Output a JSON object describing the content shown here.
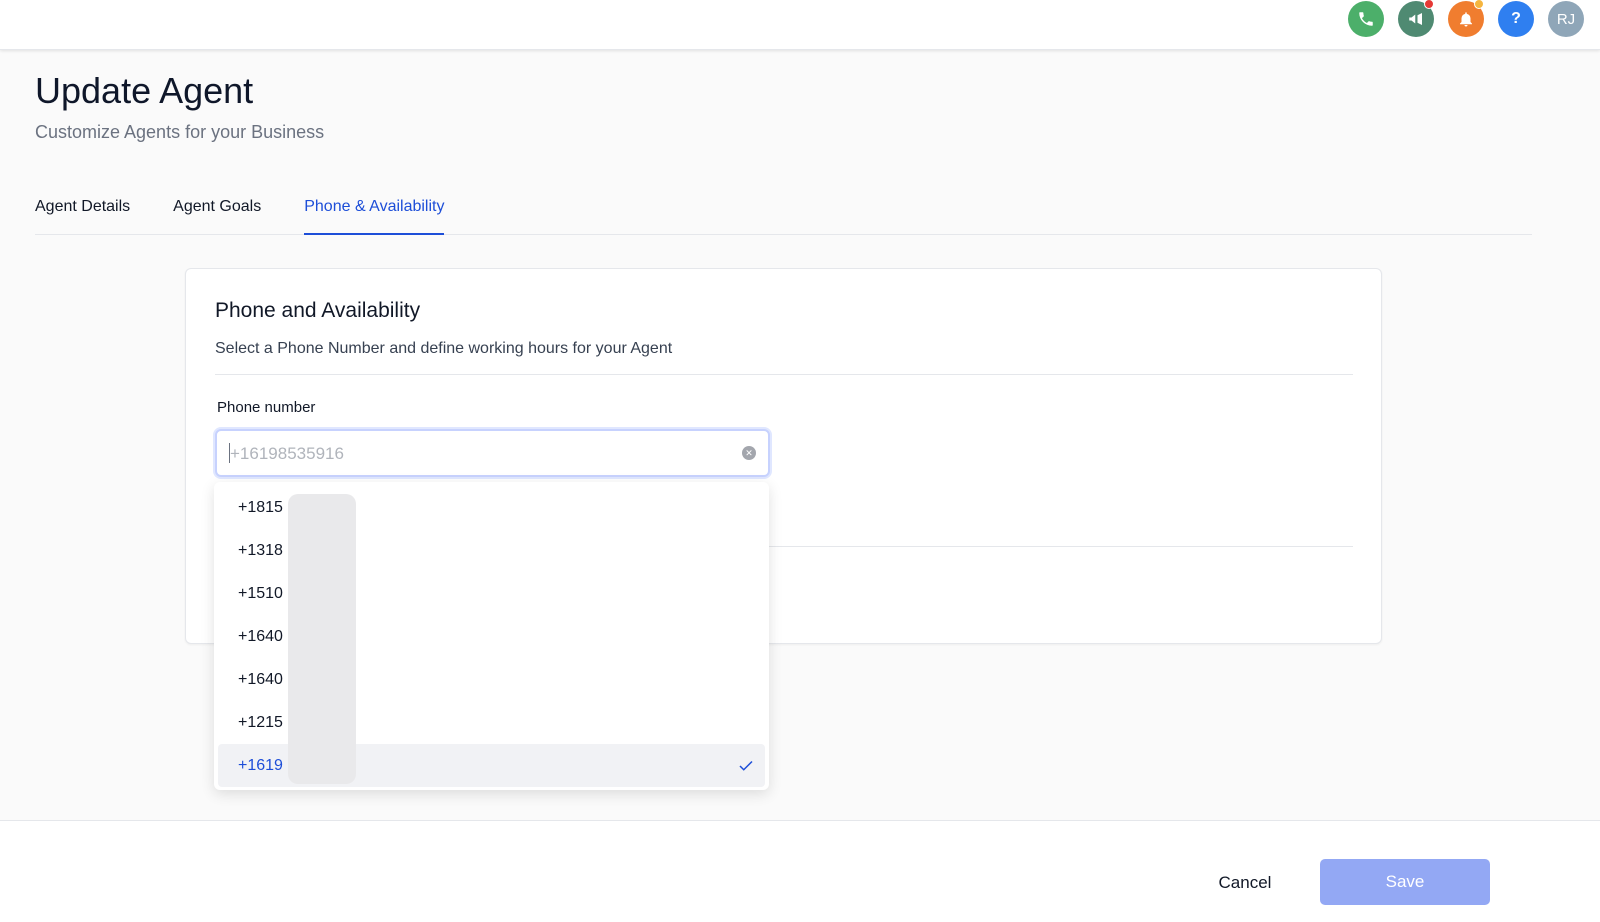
{
  "header": {
    "title": "Update Agent",
    "subtitle": "Customize Agents for your Business",
    "avatar_initials": "RJ",
    "help_glyph": "?"
  },
  "tabs": [
    {
      "label": "Agent Details",
      "active": false
    },
    {
      "label": "Agent Goals",
      "active": false
    },
    {
      "label": "Phone & Availability",
      "active": true
    }
  ],
  "card": {
    "title": "Phone and Availability",
    "description": "Select a Phone Number and define working hours for your Agent",
    "phone_label": "Phone number",
    "phone_value": "+16198535916"
  },
  "dropdown": {
    "options": [
      "+1815",
      "+1318",
      "+1510",
      "+1640",
      "+1640",
      "+1215",
      "+1619"
    ],
    "selected_index": 6
  },
  "footer": {
    "cancel_label": "Cancel",
    "save_label": "Save"
  },
  "colors": {
    "accent": "#1d4ed8",
    "save_button": "#93a8f4",
    "phone_icon_bg": "#4caf6a",
    "announce_icon_bg": "#4f8a72",
    "bell_icon_bg": "#f07d2f",
    "help_icon_bg": "#2f7ff0",
    "avatar_bg": "#8fa6b8"
  },
  "icons": [
    "phone-icon",
    "megaphone-icon",
    "bell-icon",
    "help-icon",
    "close-circle-icon",
    "checkmark-icon"
  ]
}
